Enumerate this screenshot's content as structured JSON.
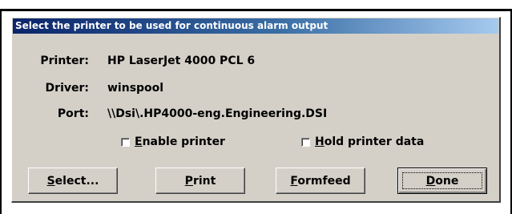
{
  "dialog": {
    "title": "Select the printer to be used for continuous alarm output"
  },
  "info": {
    "printer_label": "Printer:",
    "printer_value": "HP LaserJet 4000 PCL 6",
    "driver_label": "Driver:",
    "driver_value": "winspool",
    "port_label": "Port:",
    "port_value": "\\\\Dsi\\.HP4000-eng.Engineering.DSI"
  },
  "options": {
    "enable_printer": {
      "mnemonic": "E",
      "rest": "nable printer",
      "checked": false
    },
    "hold_printer_data": {
      "mnemonic": "H",
      "rest": "old printer data",
      "checked": false
    }
  },
  "buttons": {
    "select": {
      "mnemonic": "S",
      "rest": "elect..."
    },
    "print": {
      "mnemonic": "P",
      "rest": "rint"
    },
    "formfeed": {
      "mnemonic": "F",
      "rest": "ormfeed"
    },
    "done": {
      "mnemonic": "D",
      "rest": "one"
    }
  }
}
